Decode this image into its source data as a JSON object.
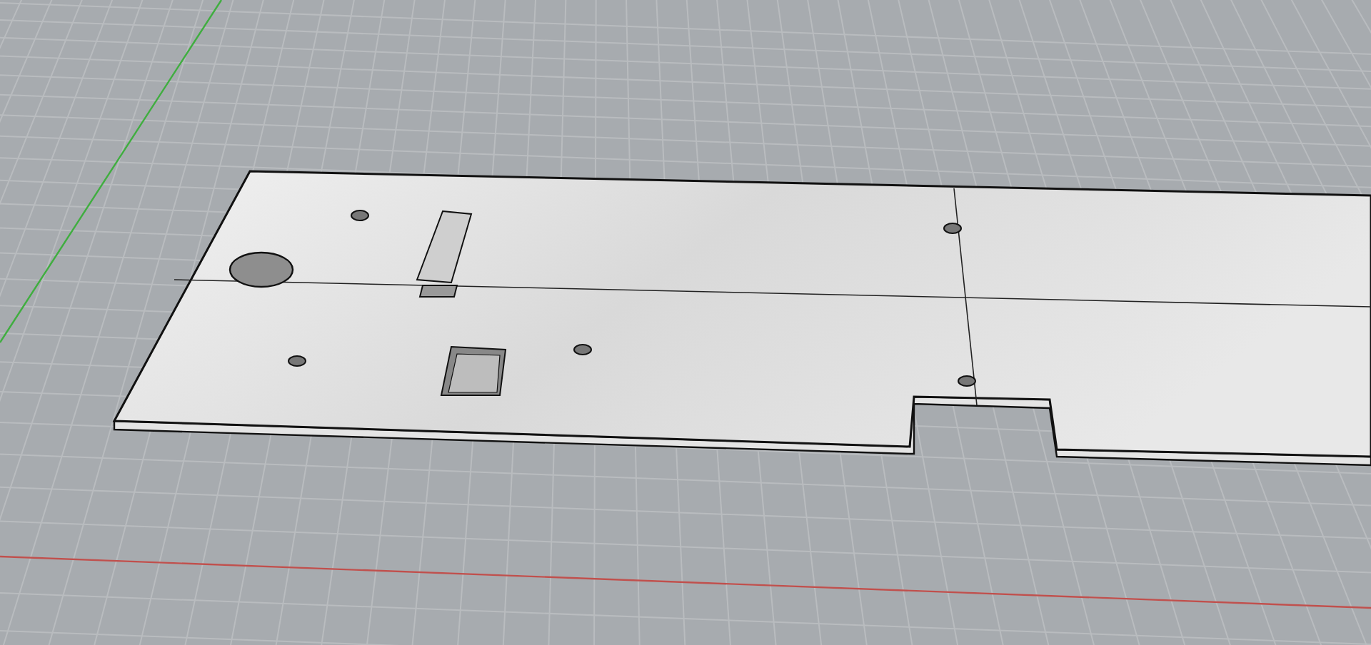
{
  "viewport": {
    "grid_visible": true,
    "axes_visible": true,
    "model_visible": true
  }
}
